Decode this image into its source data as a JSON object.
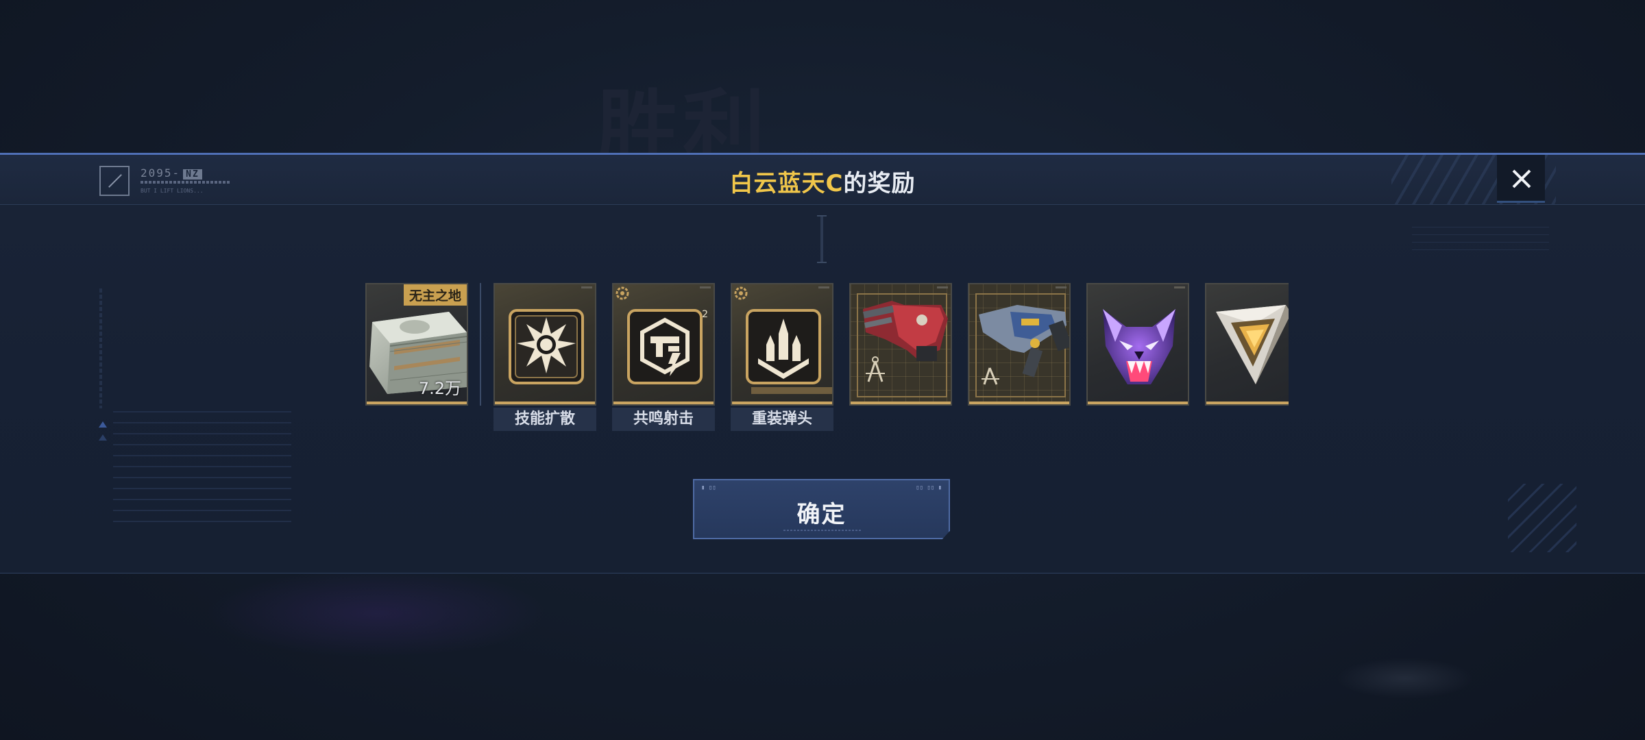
{
  "background": {
    "victory_text": "胜利"
  },
  "header": {
    "logo_text": "2095-",
    "logo_tag": "NZ",
    "logo_sub": "BUT I LIFT LIONS...",
    "player_name": "白云蓝天C",
    "title_suffix": "的奖励"
  },
  "rewards": [
    {
      "name": "cash-bundle",
      "icon": "money-stack-icon",
      "tag": "无主之地",
      "amount": "7.2万",
      "label": ""
    },
    {
      "name": "skill-spread",
      "icon": "burst-icon",
      "tag": "",
      "amount": "",
      "label": "技能扩散"
    },
    {
      "name": "resonance-shot",
      "icon": "gun-chip-icon",
      "tag": "",
      "amount": "",
      "label": "共鸣射击",
      "count": "2"
    },
    {
      "name": "heavy-warhead",
      "icon": "warhead-icon",
      "tag": "",
      "amount": "",
      "label": "重装弹头"
    },
    {
      "name": "red-weapon-blueprint",
      "icon": "red-rifle-blueprint-icon",
      "tag": "",
      "amount": "",
      "label": ""
    },
    {
      "name": "blue-weapon-blueprint",
      "icon": "blue-rifle-blueprint-icon",
      "tag": "",
      "amount": "",
      "label": ""
    },
    {
      "name": "purple-beast-mask",
      "icon": "wolf-mask-icon",
      "tag": "",
      "amount": "",
      "label": ""
    },
    {
      "name": "gold-emblem",
      "icon": "triangle-emblem-icon",
      "tag": "",
      "amount": "",
      "label": ""
    }
  ],
  "actions": {
    "confirm_label": "确定",
    "close_icon": "close-icon"
  },
  "colors": {
    "accent_gold": "#f0c64a",
    "band_border": "#4f6fb5",
    "card_bottom": "#c9a461",
    "button_bg": "#2e426a"
  }
}
